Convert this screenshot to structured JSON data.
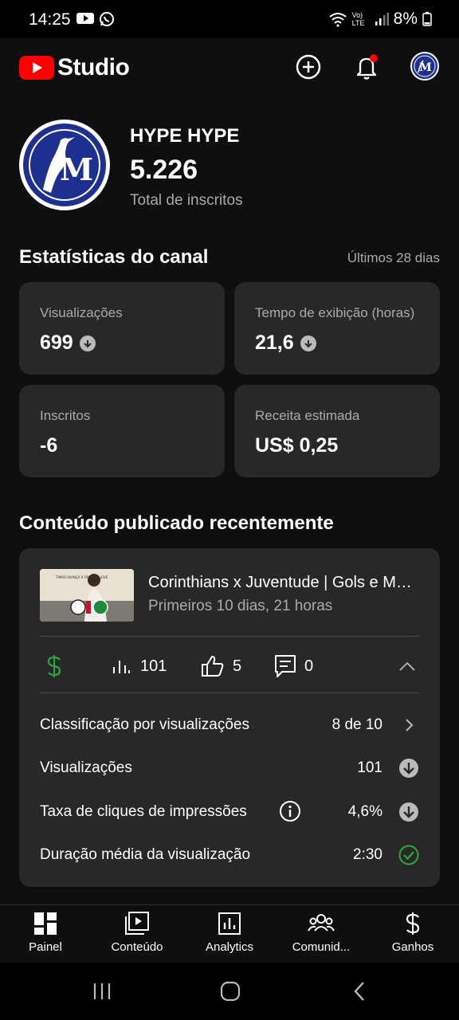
{
  "status_bar": {
    "time": "14:25",
    "network": "Vo) LTE",
    "battery": "8%"
  },
  "app_bar": {
    "logo_text": "Studio"
  },
  "channel": {
    "name": "HYPE HYPE",
    "subscribers": "5.226",
    "subscribers_label": "Total de inscritos"
  },
  "stats": {
    "title": "Estatísticas do canal",
    "period": "Últimos 28 dias",
    "cards": [
      {
        "label": "Visualizações",
        "value": "699",
        "trend": "down"
      },
      {
        "label": "Tempo de exibição (horas)",
        "value": "21,6",
        "trend": "down"
      },
      {
        "label": "Inscritos",
        "value": "-6"
      },
      {
        "label": "Receita estimada",
        "value": "US$ 0,25"
      }
    ]
  },
  "recent": {
    "title": "Conteúdo publicado recentemente",
    "video": {
      "title": "Corinthians x Juventude | Gols e Melhores Momentos",
      "subtitle": "Primeiros 10 dias, 21 horas",
      "thumbnail_caption": "TIMÃO AVANÇA À FINAL DO JUVE"
    },
    "metrics": {
      "monetization_icon": "dollar-icon",
      "views": "101",
      "likes": "5",
      "comments": "0"
    },
    "details": [
      {
        "label": "Classificação por visualizações",
        "value": "8 de 10",
        "icon": "chevron-right-icon"
      },
      {
        "label": "Visualizações",
        "value": "101",
        "icon": "arrow-down-circle-icon"
      },
      {
        "label": "Taxa de cliques de impressões",
        "value": "4,6%",
        "icon": "arrow-down-circle-icon",
        "info": true
      },
      {
        "label": "Duração média da visualização",
        "value": "2:30",
        "icon": "check-circle-icon"
      }
    ]
  },
  "bottom_nav": [
    {
      "label": "Painel",
      "icon": "dashboard-icon"
    },
    {
      "label": "Conteúdo",
      "icon": "content-icon"
    },
    {
      "label": "Analytics",
      "icon": "analytics-icon"
    },
    {
      "label": "Comunid...",
      "icon": "community-icon"
    },
    {
      "label": "Ganhos",
      "icon": "dollar-icon"
    }
  ],
  "colors": {
    "background": "#0f0f0f",
    "card": "#282828",
    "accent_red": "#ff0000",
    "positive_green": "#2ba640",
    "channel_blue": "#1d2f8f"
  }
}
